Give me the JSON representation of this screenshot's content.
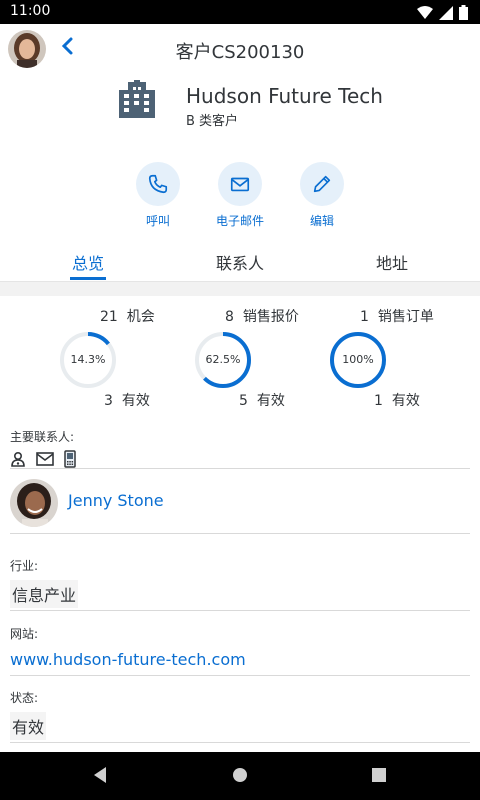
{
  "status_bar": {
    "time": "11:00"
  },
  "header": {
    "title": "客户CS200130"
  },
  "company": {
    "name": "Hudson Future Tech",
    "type": "B 类客户"
  },
  "actions": [
    {
      "label": "呼叫",
      "icon": "phone-icon"
    },
    {
      "label": "电子邮件",
      "icon": "mail-icon"
    },
    {
      "label": "编辑",
      "icon": "pencil-icon"
    }
  ],
  "tabs": [
    {
      "label": "总览",
      "active": true
    },
    {
      "label": "联系人",
      "active": false
    },
    {
      "label": "地址",
      "active": false
    }
  ],
  "kpis": [
    {
      "top_count": "21",
      "top_label": "机会",
      "percent": "14.3%",
      "fraction": 0.143,
      "bottom_count": "3",
      "bottom_label": "有效"
    },
    {
      "top_count": "8",
      "top_label": "销售报价",
      "percent": "62.5%",
      "fraction": 0.625,
      "bottom_count": "5",
      "bottom_label": "有效"
    },
    {
      "top_count": "1",
      "top_label": "销售订单",
      "percent": "100%",
      "fraction": 1.0,
      "bottom_count": "1",
      "bottom_label": "有效"
    }
  ],
  "primary_contact": {
    "label": "主要联系人:",
    "name": "Jenny Stone"
  },
  "fields": {
    "industry": {
      "label": "行业:",
      "value": "信息产业"
    },
    "website": {
      "label": "网站:",
      "value": "www.hudson-future-tech.com"
    },
    "status": {
      "label": "状态:",
      "value": "有效"
    }
  },
  "colors": {
    "accent": "#0a6ed1",
    "text": "#32363a",
    "ring_track": "#e8ecef",
    "action_bg": "#e5f0fa"
  }
}
